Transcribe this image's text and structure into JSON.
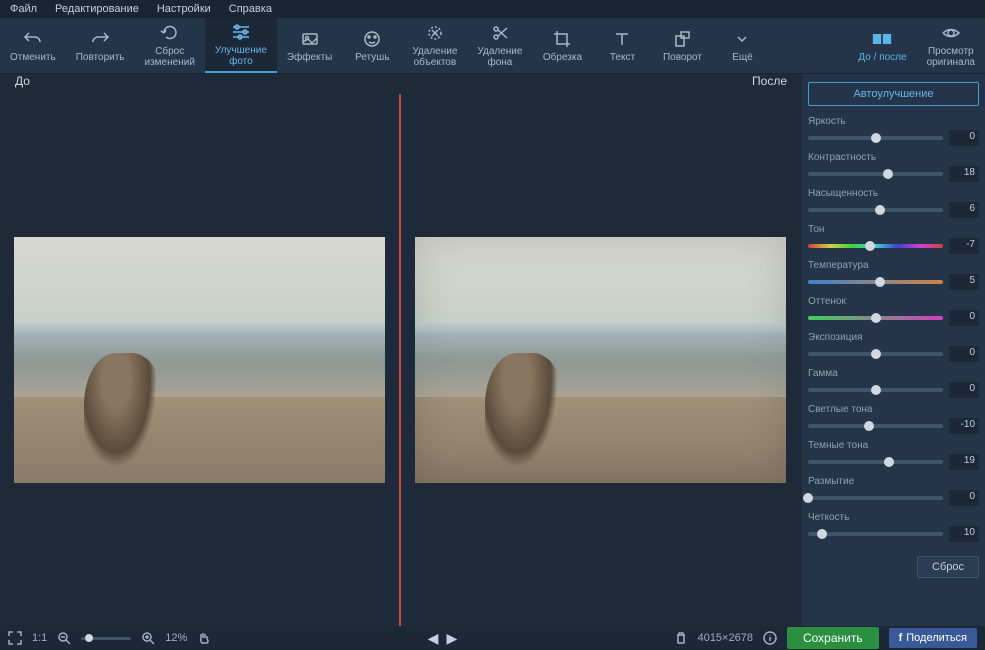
{
  "menu": {
    "items": [
      "Файл",
      "Редактирование",
      "Настройки",
      "Справка"
    ]
  },
  "toolbar": {
    "undo": "Отменить",
    "redo": "Повторить",
    "reset": "Сброс\nизменений",
    "enhance": "Улучшение\nфото",
    "effects": "Эффекты",
    "retouch": "Ретушь",
    "objremove": "Удаление\nобъектов",
    "bgremove": "Удаление\nфона",
    "crop": "Обрезка",
    "text": "Текст",
    "rotate": "Поворот",
    "more": "Ещё",
    "beforeafter": "До / после",
    "vieworig": "Просмотр\nоригинала"
  },
  "compare": {
    "before": "До",
    "after": "После"
  },
  "panel": {
    "auto": "Автоулучшение",
    "sliders": [
      {
        "name": "Яркость",
        "value": 0,
        "pos": 50
      },
      {
        "name": "Контрастность",
        "value": 18,
        "pos": 59
      },
      {
        "name": "Насыщенность",
        "value": 6,
        "pos": 53
      },
      {
        "name": "Тон",
        "value": -7,
        "pos": 46,
        "track": "hue"
      },
      {
        "name": "Температура",
        "value": 5,
        "pos": 53,
        "track": "temp"
      },
      {
        "name": "Оттенок",
        "value": 0,
        "pos": 50,
        "track": "tint"
      },
      {
        "name": "Экспозиция",
        "value": 0,
        "pos": 50
      },
      {
        "name": "Гамма",
        "value": 0,
        "pos": 50
      },
      {
        "name": "Светлые тона",
        "value": -10,
        "pos": 45
      },
      {
        "name": "Темные тона",
        "value": 19,
        "pos": 60
      },
      {
        "name": "Размытие",
        "value": 0,
        "pos": 0
      },
      {
        "name": "Четкость",
        "value": 10,
        "pos": 10
      }
    ],
    "reset": "Сброс"
  },
  "status": {
    "ratio": "1:1",
    "zoom": "12%",
    "dims": "4015×2678",
    "save": "Сохранить",
    "share": "Поделиться"
  }
}
